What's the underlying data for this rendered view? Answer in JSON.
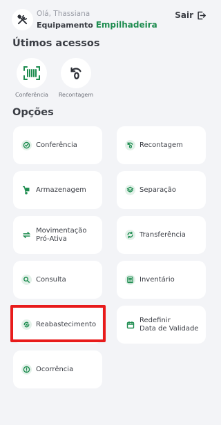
{
  "header": {
    "greeting": "Olá, Thassiana",
    "equipment_prefix": "Equipamento",
    "equipment_name": "Empilhadeira",
    "logout_label": "Sair"
  },
  "recent": {
    "title": "Útimos acessos",
    "items": [
      {
        "label": "Conferência",
        "icon": "barcode-scan-icon"
      },
      {
        "label": "Recontagem",
        "icon": "recount-icon"
      }
    ]
  },
  "options": {
    "title": "Opções",
    "items": [
      {
        "label_1": "Conferência",
        "label_2": "",
        "icon": "check-circle-icon"
      },
      {
        "label_1": "Recontagem",
        "label_2": "",
        "icon": "recount-icon"
      },
      {
        "label_1": "Armazenagem",
        "label_2": "",
        "icon": "hand-truck-icon"
      },
      {
        "label_1": "Separação",
        "label_2": "",
        "icon": "layers-icon"
      },
      {
        "label_1": "Movimentação",
        "label_2": "Pró-Ativa",
        "icon": "swap-arrows-icon"
      },
      {
        "label_1": "Transferência",
        "label_2": "",
        "icon": "sync-icon"
      },
      {
        "label_1": "Consulta",
        "label_2": "",
        "icon": "search-icon"
      },
      {
        "label_1": "Inventário",
        "label_2": "",
        "icon": "list-icon"
      },
      {
        "label_1": "Reabastecimento",
        "label_2": "",
        "icon": "refill-icon"
      },
      {
        "label_1": "Redefinir",
        "label_2": "Data de Validade",
        "icon": "calendar-icon"
      },
      {
        "label_1": "Ocorrência",
        "label_2": "",
        "icon": "alert-circle-icon"
      }
    ]
  },
  "colors": {
    "accent": "#1d8c4f",
    "icon_bg": "#e3f1e9",
    "background": "#f3f4f7",
    "highlight": "#e81b1b"
  }
}
